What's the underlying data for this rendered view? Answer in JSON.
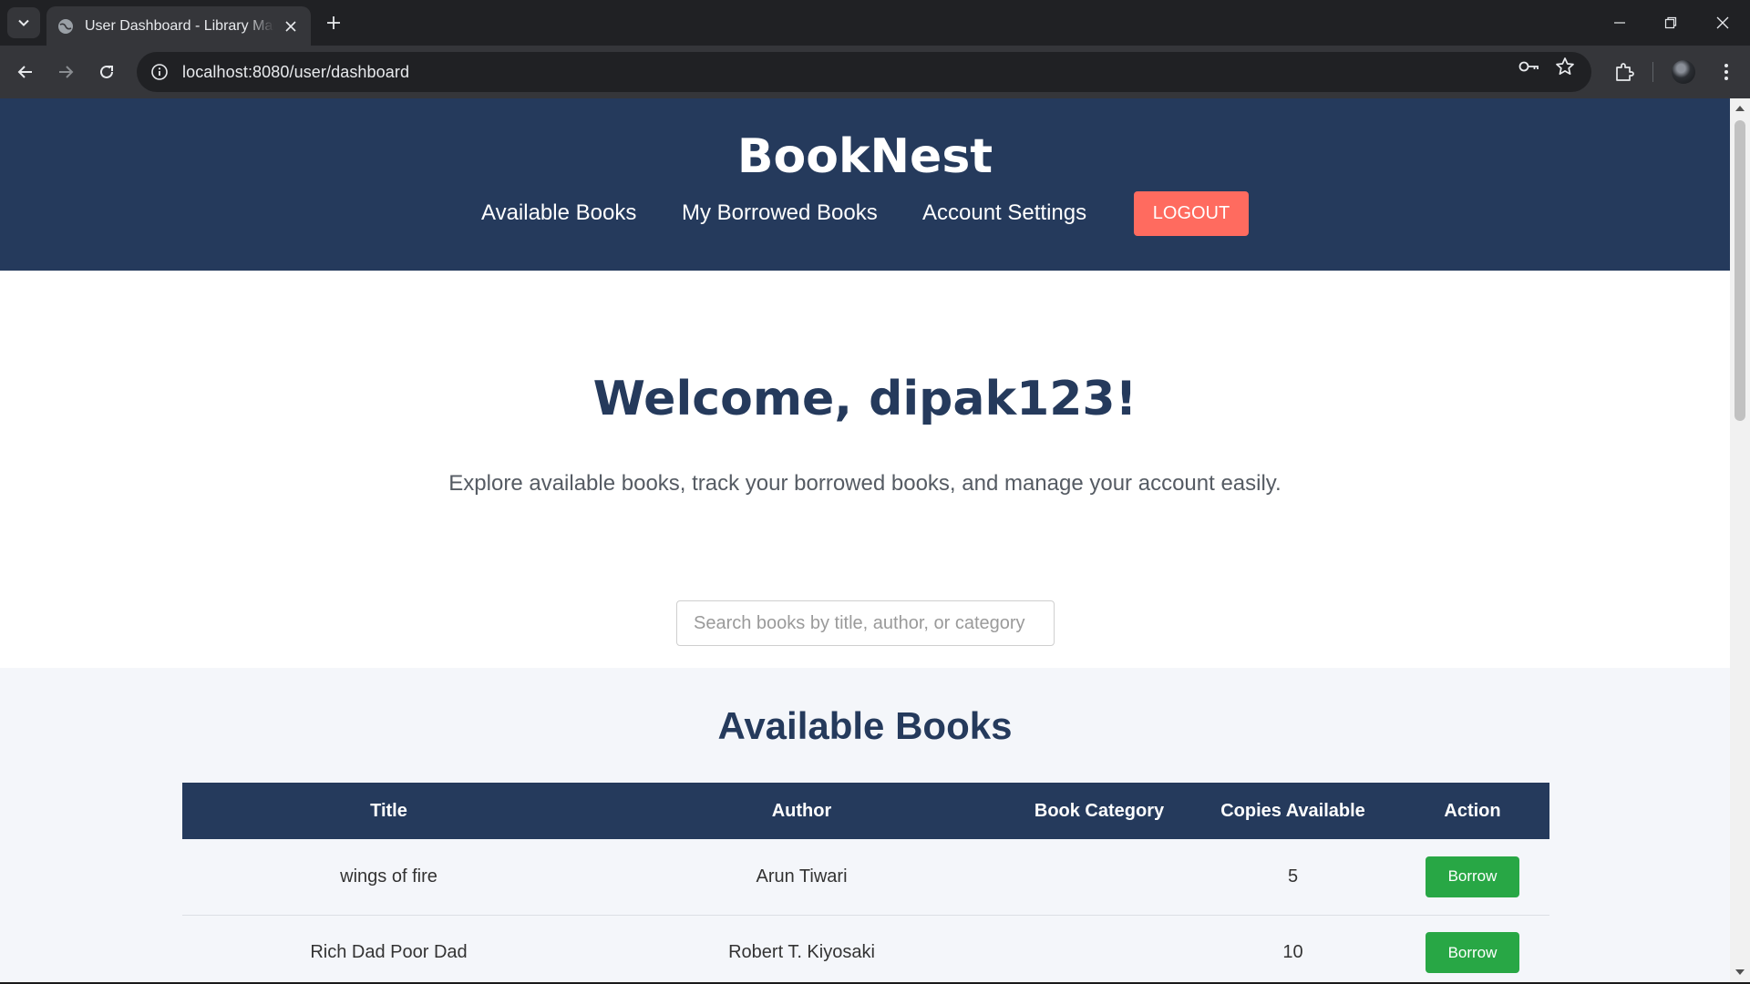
{
  "browser": {
    "tab_title": "User Dashboard - Library Management",
    "url": "localhost:8080/user/dashboard"
  },
  "site": {
    "brand": "BookNest",
    "nav": {
      "available_books": "Available Books",
      "borrowed_books": "My Borrowed Books",
      "account_settings": "Account Settings",
      "logout": "LOGOUT"
    },
    "colors": {
      "header_bg": "#253a5c",
      "logout_bg": "#ff6b5f",
      "borrow_bg": "#28a745"
    }
  },
  "main": {
    "welcome": "Welcome, dipak123!",
    "subtitle": "Explore available books, track your borrowed books, and manage your account easily.",
    "search_placeholder": "Search books by title, author, or category"
  },
  "books": {
    "section_title": "Available Books",
    "columns": [
      "Title",
      "Author",
      "Book Category",
      "Copies Available",
      "Action"
    ],
    "rows": [
      {
        "title": "wings of fire",
        "author": "Arun Tiwari",
        "category": "",
        "copies": "5",
        "action": "Borrow"
      },
      {
        "title": "Rich Dad Poor Dad",
        "author": "Robert T. Kiyosaki",
        "category": "",
        "copies": "10",
        "action": "Borrow"
      }
    ]
  }
}
